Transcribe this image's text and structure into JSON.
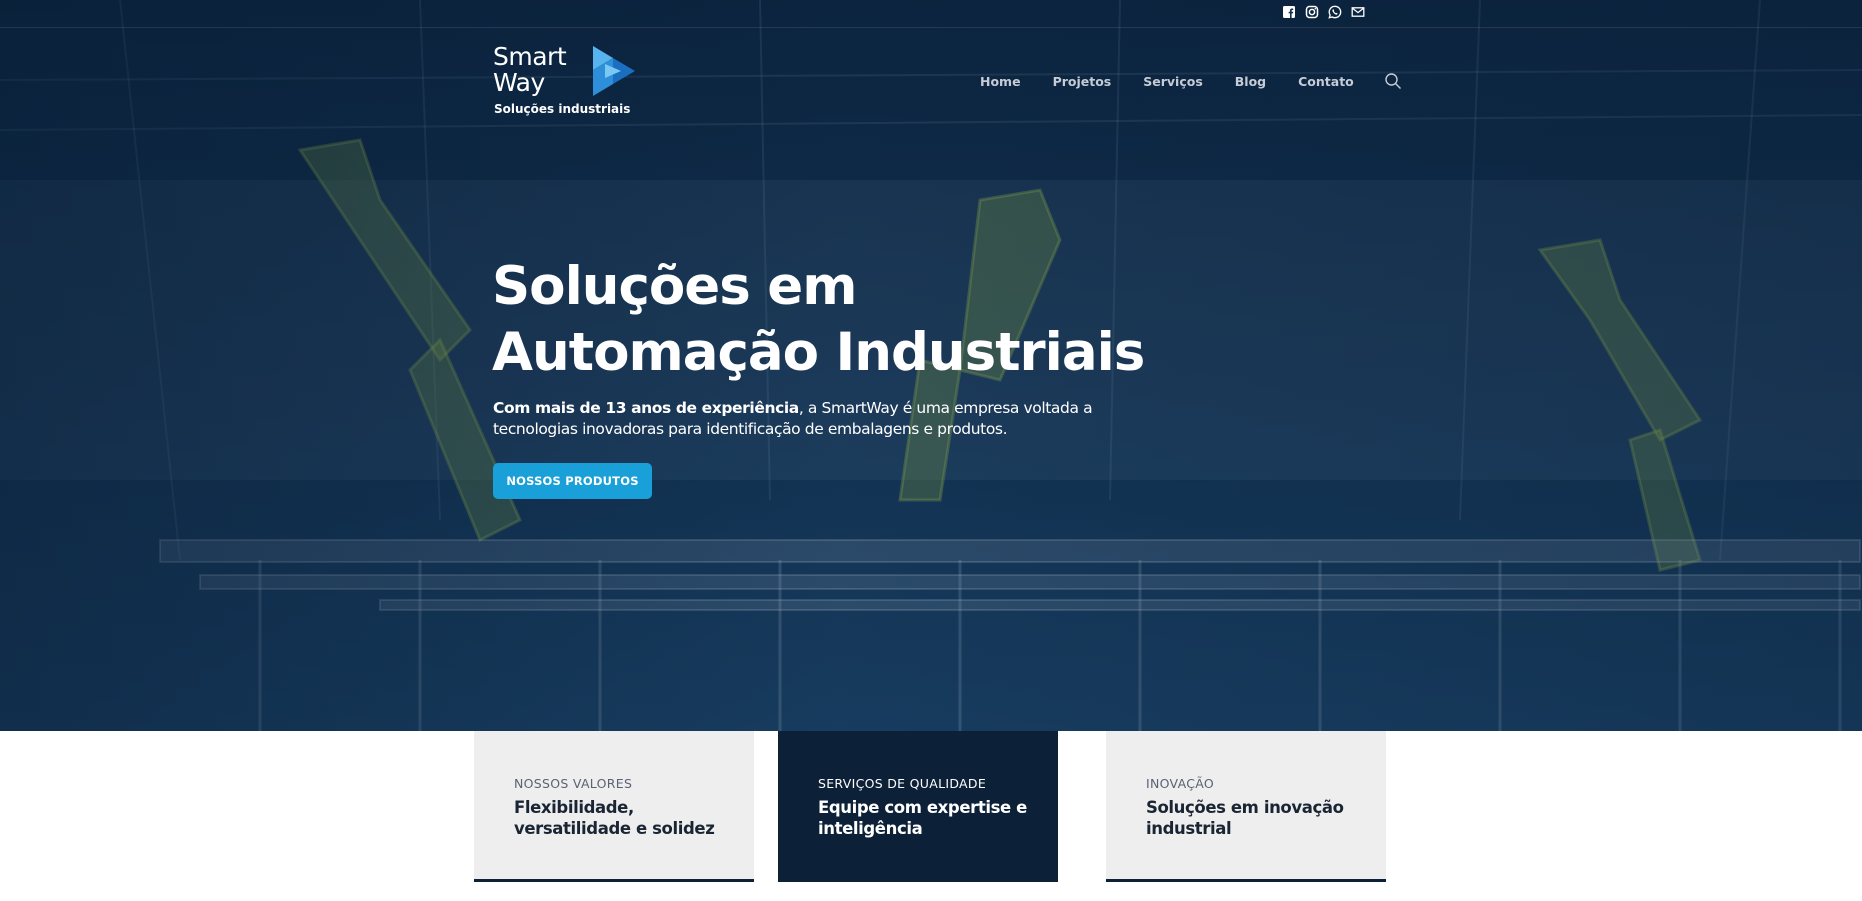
{
  "topbar": {
    "social": [
      {
        "icon": "facebook-icon"
      },
      {
        "icon": "instagram-icon"
      },
      {
        "icon": "whatsapp-icon"
      },
      {
        "icon": "email-icon"
      }
    ]
  },
  "logo": {
    "line1": "Smart",
    "line2": "Way",
    "tagline": "Soluções industriais"
  },
  "nav": {
    "items": [
      "Home",
      "Projetos",
      "Serviços",
      "Blog",
      "Contato"
    ],
    "search_icon": "search-icon"
  },
  "hero": {
    "title_line1": "Soluções em",
    "title_line2": "Automação Industriais",
    "subtitle_bold": "Com mais de 13 anos de experiência",
    "subtitle_rest": ", a SmartWay é uma empresa voltada a tecnologias inovadoras para identificação de embalagens e produtos.",
    "cta_label": "NOSSOS PRODUTOS"
  },
  "cards": [
    {
      "label": "NOSSOS VALORES",
      "text": "Flexibilidade, versatilidade e solidez"
    },
    {
      "label": "SERVIÇOS DE QUALIDADE",
      "text": "Equipe com expertise e inteligência"
    },
    {
      "label": "INOVAÇÃO",
      "text": "Soluções em inovação industrial"
    }
  ],
  "colors": {
    "hero_overlay": "#0c2540",
    "accent": "#1aa0d8",
    "logo_blue": "#2d8fd9",
    "card_light": "#eeeeef",
    "card_dark": "#0c2038"
  }
}
